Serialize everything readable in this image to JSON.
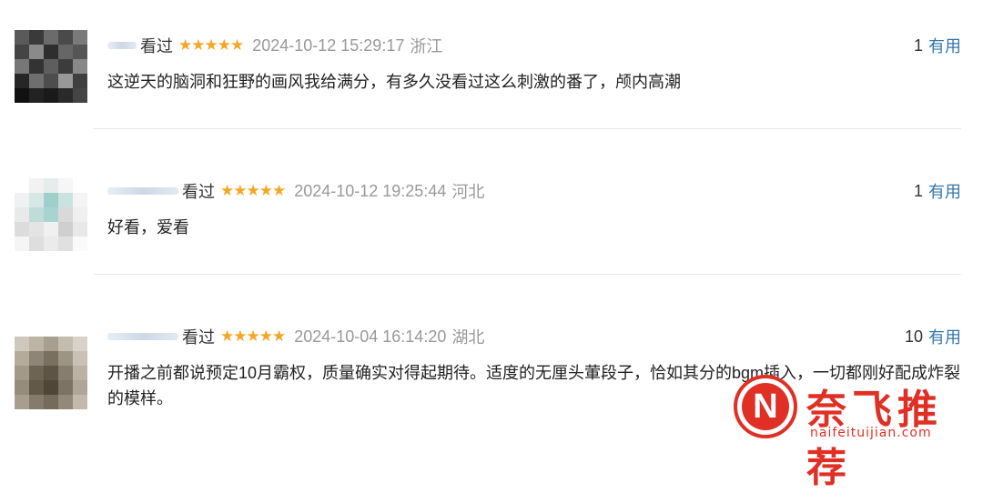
{
  "reviews": [
    {
      "status": "看过",
      "stars": "★★★★★",
      "time": "2024-10-12 15:29:17",
      "location": "浙江",
      "useful_count": "1",
      "useful_label": "有用",
      "content": "这逆天的脑洞和狂野的画风我给满分，有多久没看过这么刺激的番了，颅内高潮"
    },
    {
      "status": "看过",
      "stars": "★★★★★",
      "time": "2024-10-12 19:25:44",
      "location": "河北",
      "useful_count": "1",
      "useful_label": "有用",
      "content": "好看，爱看"
    },
    {
      "status": "看过",
      "stars": "★★★★★",
      "time": "2024-10-04 16:14:20",
      "location": "湖北",
      "useful_count": "10",
      "useful_label": "有用",
      "content": "开播之前都说预定10月霸权，质量确实对得起期待。适度的无厘头葷段子，恰如其分的bgm插入，一切都刚好配成炸裂的模样。"
    }
  ],
  "watermark": {
    "logo_letter": "N",
    "title": "奈飞推荐",
    "url": "naifeituijian.com"
  },
  "colors": {
    "star": "#f5a623",
    "useful_link": "#3377aa",
    "meta_gray": "#999999",
    "watermark_red": "#e03026"
  }
}
